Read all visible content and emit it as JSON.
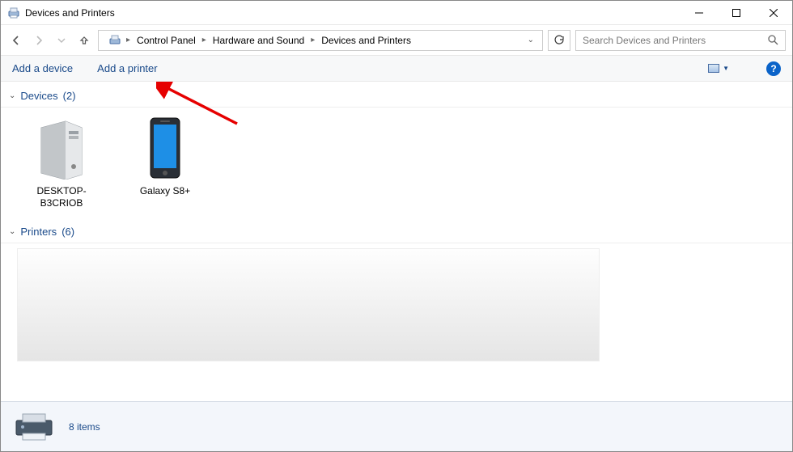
{
  "window": {
    "title": "Devices and Printers"
  },
  "breadcrumb": {
    "items": [
      "Control Panel",
      "Hardware and Sound",
      "Devices and Printers"
    ]
  },
  "search": {
    "placeholder": "Search Devices and Printers"
  },
  "toolbar": {
    "add_device": "Add a device",
    "add_printer": "Add a printer"
  },
  "groups": {
    "devices": {
      "label": "Devices",
      "count": "(2)"
    },
    "printers": {
      "label": "Printers",
      "count": "(6)"
    }
  },
  "devices": [
    {
      "name": "DESKTOP-B3CRIOB"
    },
    {
      "name": "Galaxy S8+"
    }
  ],
  "status": {
    "text": "8 items"
  },
  "help": {
    "glyph": "?"
  }
}
